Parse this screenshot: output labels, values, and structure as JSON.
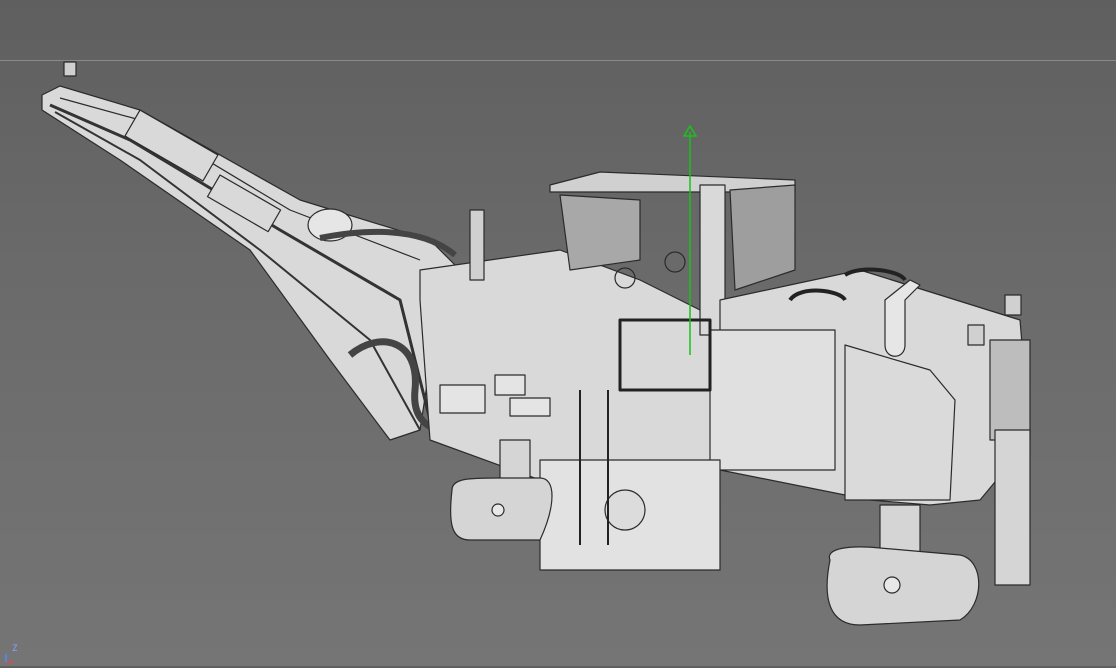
{
  "viewport": {
    "axis_indicator": {
      "label": "Z",
      "icon": "axis-gizmo-icon"
    },
    "model": {
      "name_icon": "road-milling-machine-wireframe",
      "colors": {
        "body": "#d8d8d8",
        "edge": "#2a2a2a",
        "move_gizmo_y": "#19c219"
      }
    }
  }
}
